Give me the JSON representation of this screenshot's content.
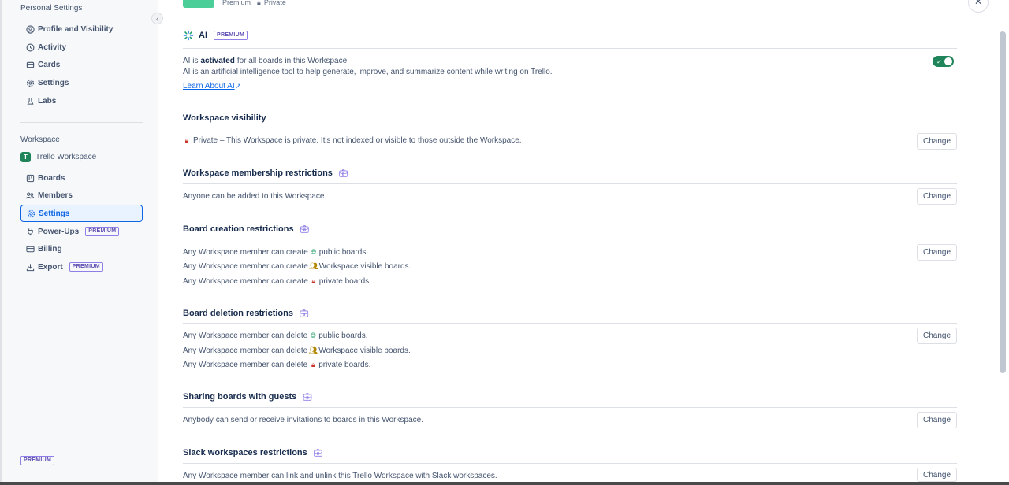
{
  "sidebar": {
    "personal_heading": "Personal Settings",
    "personal_items": [
      {
        "label": "Profile and Visibility",
        "icon": "profile-icon"
      },
      {
        "label": "Activity",
        "icon": "history-icon"
      },
      {
        "label": "Cards",
        "icon": "cards-icon"
      },
      {
        "label": "Settings",
        "icon": "gear-icon"
      },
      {
        "label": "Labs",
        "icon": "flask-icon"
      }
    ],
    "workspace_heading": "Workspace",
    "workspace_name": "Trello Workspace",
    "workspace_avatar": "T",
    "workspace_items": [
      {
        "label": "Boards",
        "icon": "boards-icon"
      },
      {
        "label": "Members",
        "icon": "members-icon"
      },
      {
        "label": "Settings",
        "icon": "gear-icon",
        "active": true
      },
      {
        "label": "Power-Ups",
        "icon": "plug-icon",
        "badge": "PREMIUM"
      },
      {
        "label": "Billing",
        "icon": "card-icon"
      },
      {
        "label": "Export",
        "icon": "download-icon",
        "badge": "PREMIUM"
      }
    ],
    "bottom_badge": "PREMIUM"
  },
  "top": {
    "plan": "Premium",
    "visibility": "Private"
  },
  "ai": {
    "title": "AI",
    "badge": "PREMIUM",
    "line1_prefix": "AI is ",
    "line1_bold": "activated",
    "line1_suffix": " for all boards in this Workspace.",
    "line2": "AI is an artificial intelligence tool to help generate, improve, and summarize content while writing on Trello.",
    "learn_link": "Learn About AI",
    "enabled": true
  },
  "sections": {
    "visibility": {
      "title": "Workspace visibility",
      "text": "Private – This Workspace is private. It's not indexed or visible to those outside the Workspace."
    },
    "membership": {
      "title": "Workspace membership restrictions",
      "text": "Anyone can be added to this Workspace."
    },
    "creation": {
      "title": "Board creation restrictions",
      "lines": [
        {
          "prefix": "Any Workspace member can create",
          "suffix": "public boards."
        },
        {
          "prefix": "Any Workspace member can create",
          "suffix": "Workspace visible boards."
        },
        {
          "prefix": "Any Workspace member can create",
          "suffix": "private boards."
        }
      ]
    },
    "deletion": {
      "title": "Board deletion restrictions",
      "lines": [
        {
          "prefix": "Any Workspace member can delete",
          "suffix": "public boards."
        },
        {
          "prefix": "Any Workspace member can delete",
          "suffix": "Workspace visible boards."
        },
        {
          "prefix": "Any Workspace member can delete",
          "suffix": "private boards."
        }
      ]
    },
    "guests": {
      "title": "Sharing boards with guests",
      "text": "Anybody can send or receive invitations to boards in this Workspace."
    },
    "slack": {
      "title": "Slack workspaces restrictions",
      "text": "Any Workspace member can link and unlink this Trello Workspace with Slack workspaces."
    }
  },
  "change_label": "Change"
}
